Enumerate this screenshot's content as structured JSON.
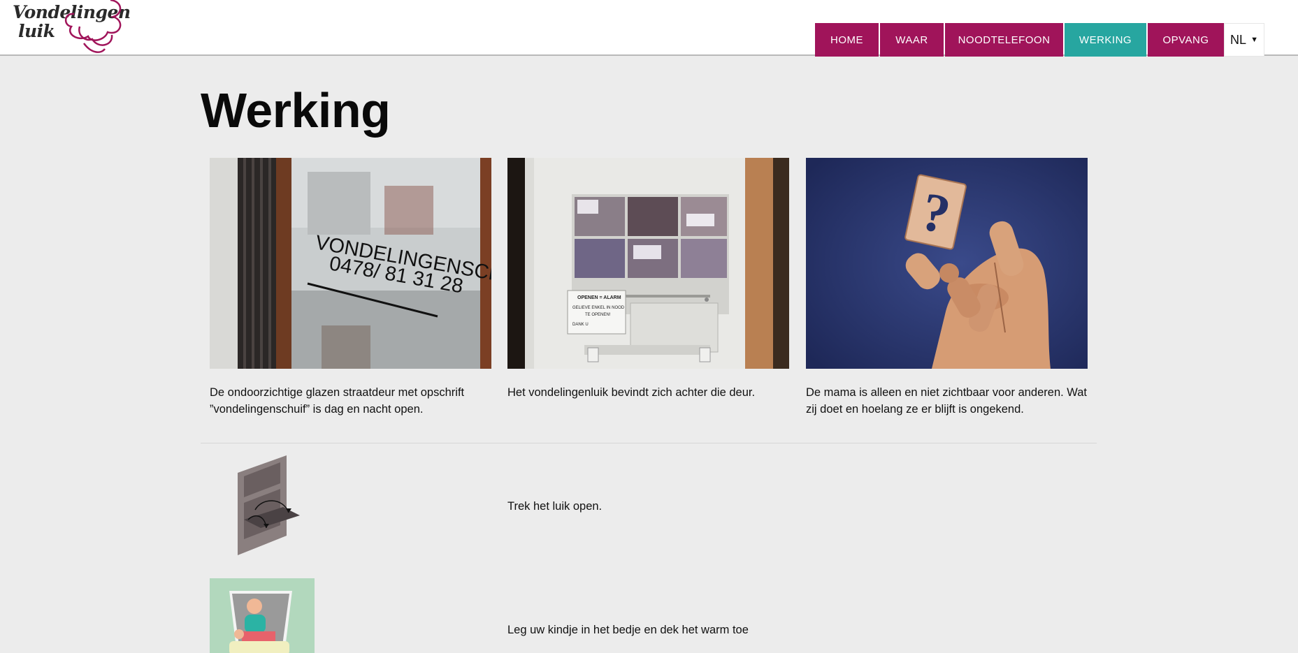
{
  "header": {
    "logo_line1": "Vondelingen",
    "logo_line2": "luik",
    "brand_color": "#a0145a",
    "active_color": "#27a6a0"
  },
  "nav": {
    "home": "HOME",
    "waar": "WAAR",
    "noodtelefoon": "NOODTELEFOON",
    "werking": "WERKING",
    "opvang": "OPVANG",
    "language": "NL"
  },
  "main": {
    "title": "Werking",
    "cards": [
      {
        "image": "glass-street-door-photo",
        "caption": "De ondoorzichtige glazen straatdeur met opschrift ”vondelingenschuif” is dag en nacht open.",
        "door_text_1": "VONDELINGENSCHUIF",
        "door_text_2": "0478/ 81 31 28"
      },
      {
        "image": "baby-hatch-door-photo",
        "caption": "Het vondelingenluik bevindt zich achter die deur.",
        "sign_title": "OPENEN = ALARM",
        "sign_line1": "GELIEVE ENKEL IN NOOD",
        "sign_line2": "TE OPENEN!",
        "sign_line3": "DANK U"
      },
      {
        "image": "wooden-hand-question-photo",
        "caption": "De mama is alleen en niet zichtbaar voor anderen. Wat zij doet en hoelang ze er blijft is ongekend.",
        "card_symbol": "?"
      }
    ],
    "steps": [
      {
        "icon": "open-hatch-icon",
        "text": "Trek het luik open."
      },
      {
        "icon": "baby-in-bed-icon",
        "text": "Leg uw kindje in het bedje en dek het warm toe"
      }
    ]
  }
}
